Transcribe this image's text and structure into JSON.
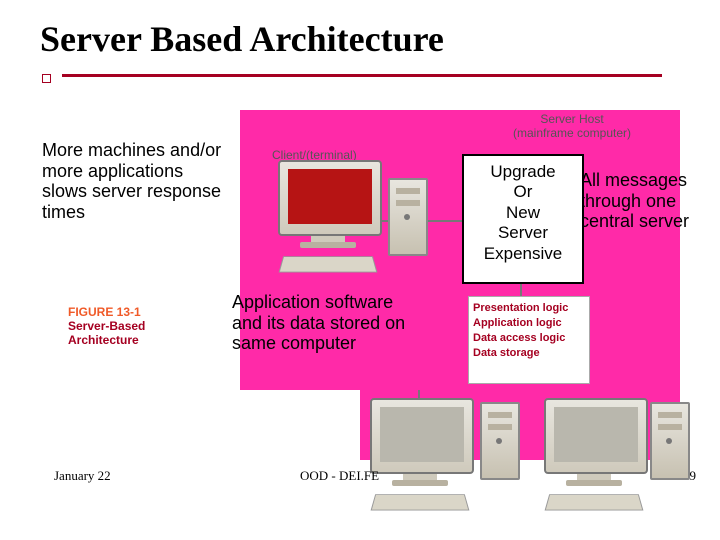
{
  "title": "Server Based Architecture",
  "annotations": {
    "left": "More machines and/or more applications slows server response times",
    "center": "Application software and its data stored on same computer",
    "right": "All messages through one central server"
  },
  "diagram": {
    "client_label": "Client/(terminal)",
    "host_label_line1": "Server Host",
    "host_label_line2": "(mainframe computer)",
    "server_box": {
      "l1": "Upgrade",
      "l2": "Or",
      "l3": "New",
      "l4": "Server",
      "l5": "Expensive"
    },
    "logic_box": {
      "l1": "Presentation logic",
      "l2": "Application logic",
      "l3": "Data access logic",
      "l4": "Data storage"
    }
  },
  "figure_caption": {
    "fig": "FIGURE 13-1",
    "title": "Server-Based Architecture"
  },
  "footer": {
    "date": "January 22",
    "center": "OOD - DEI.FE",
    "page": "9"
  }
}
